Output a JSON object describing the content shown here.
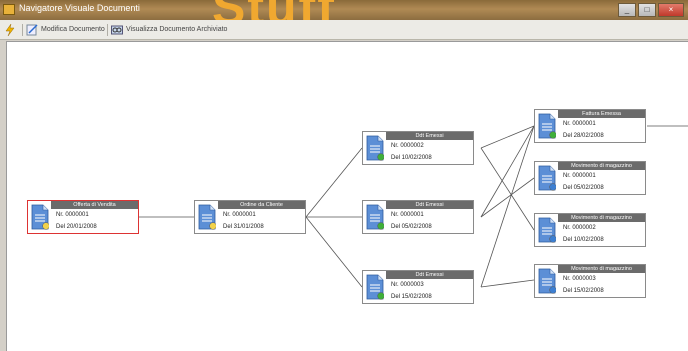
{
  "window": {
    "title": "Navigatore Visuale Documenti",
    "overlay_text": "Stuff",
    "buttons": [
      "_",
      "□",
      "×"
    ]
  },
  "toolbar": {
    "modify_label": "Modifica Documento",
    "view_archived_label": "Visualizza Documento Archiviato"
  },
  "nodes": [
    {
      "header": "Offerta di Vendita",
      "number": "Nr. 0000001",
      "date": "Del 20/01/2008",
      "badge": "yellow",
      "selected": true
    },
    {
      "header": "Ordine da Cliente",
      "number": "Nr. 0000001",
      "date": "Del 31/01/2008",
      "badge": "yellow"
    },
    {
      "header": "Ddt Emessi",
      "number": "Nr. 0000002",
      "date": "Del 10/02/2008",
      "badge": "green"
    },
    {
      "header": "Ddt Emessi",
      "number": "Nr. 0000001",
      "date": "Del 05/02/2008",
      "badge": "green"
    },
    {
      "header": "Ddt Emessi",
      "number": "Nr. 0000003",
      "date": "Del 15/02/2008",
      "badge": "green"
    },
    {
      "header": "Fattura Emessa",
      "number": "Nr. 0000001",
      "date": "Del 28/02/2008",
      "badge": "green"
    },
    {
      "header": "Movimento di magazzino",
      "number": "Nr. 0000001",
      "date": "Del 05/02/2008",
      "badge": "blue"
    },
    {
      "header": "Movimento di magazzino",
      "number": "Nr. 0000002",
      "date": "Del 10/02/2008",
      "badge": "blue"
    },
    {
      "header": "Movimento di magazzino",
      "number": "Nr. 0000003",
      "date": "Del 15/02/2008",
      "badge": "blue"
    }
  ],
  "colors": {
    "badge_yellow": "#f2d24b",
    "badge_green": "#3fae3a",
    "badge_blue": "#3d7fd1",
    "doc_blue": "#5c8fd6",
    "selected_border": "#dd3333"
  }
}
